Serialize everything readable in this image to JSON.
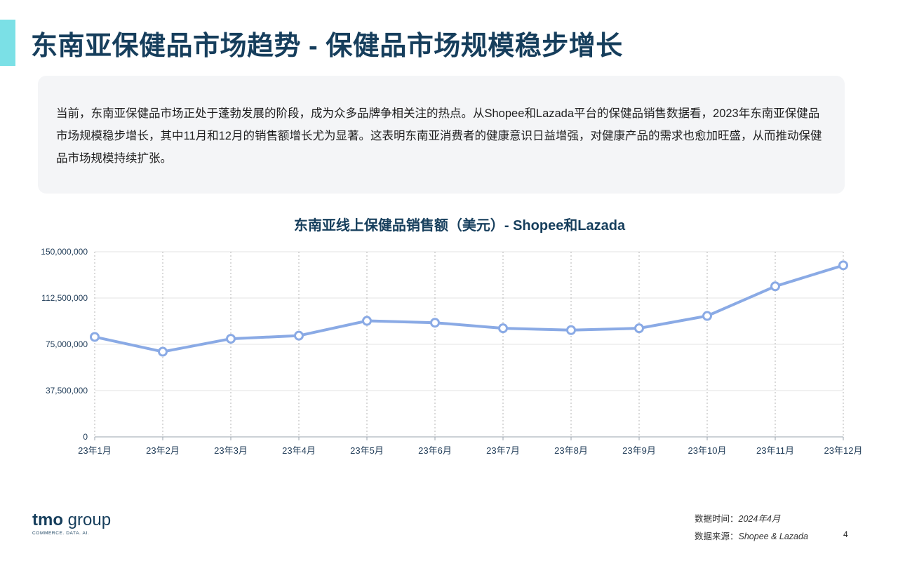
{
  "page": {
    "title": "东南亚保健品市场趋势 - 保健品市场规模稳步增长",
    "summary": "当前，东南亚保健品市场正处于蓬勃发展的阶段，成为众多品牌争相关注的热点。从Shopee和Lazada平台的保健品销售数据看，2023年东南亚保健品市场规模稳步增长，其中11月和12月的销售额增长尤为显著。这表明东南亚消费者的健康意识日益增强，对健康产品的需求也愈加旺盛，从而推动保健品市场规模持续扩张。",
    "page_number": "4"
  },
  "footer": {
    "logo_tmo": "tmo",
    "logo_group": "group",
    "logo_tagline": "COMMERCE. DATA. AI.",
    "data_time_label": "数据时间：",
    "data_time_value": "2024年4月",
    "data_source_label": "数据来源：",
    "data_source_value": "Shopee & Lazada"
  },
  "colors": {
    "accent": "#7be0e6",
    "title": "#163e5c",
    "line": "#8aaae5",
    "axis_text": "#1f3b57"
  },
  "chart_data": {
    "type": "line",
    "title": "东南亚线上保健品销售额（美元）- Shopee和Lazada",
    "categories": [
      "23年1月",
      "23年2月",
      "23年3月",
      "23年4月",
      "23年5月",
      "23年6月",
      "23年7月",
      "23年8月",
      "23年9月",
      "23年10月",
      "23年11月",
      "23年12月"
    ],
    "series": [
      {
        "values": [
          81000000,
          69000000,
          79500000,
          82000000,
          94000000,
          92500000,
          88000000,
          86500000,
          88000000,
          98000000,
          122000000,
          139000000
        ]
      }
    ],
    "yticks": [
      "0",
      "37,500,000",
      "75,000,000",
      "112,500,000",
      "150,000,000"
    ],
    "ylim": [
      0,
      150000000
    ],
    "grid": "horizontal solid, vertical dotted",
    "legend": "none"
  }
}
